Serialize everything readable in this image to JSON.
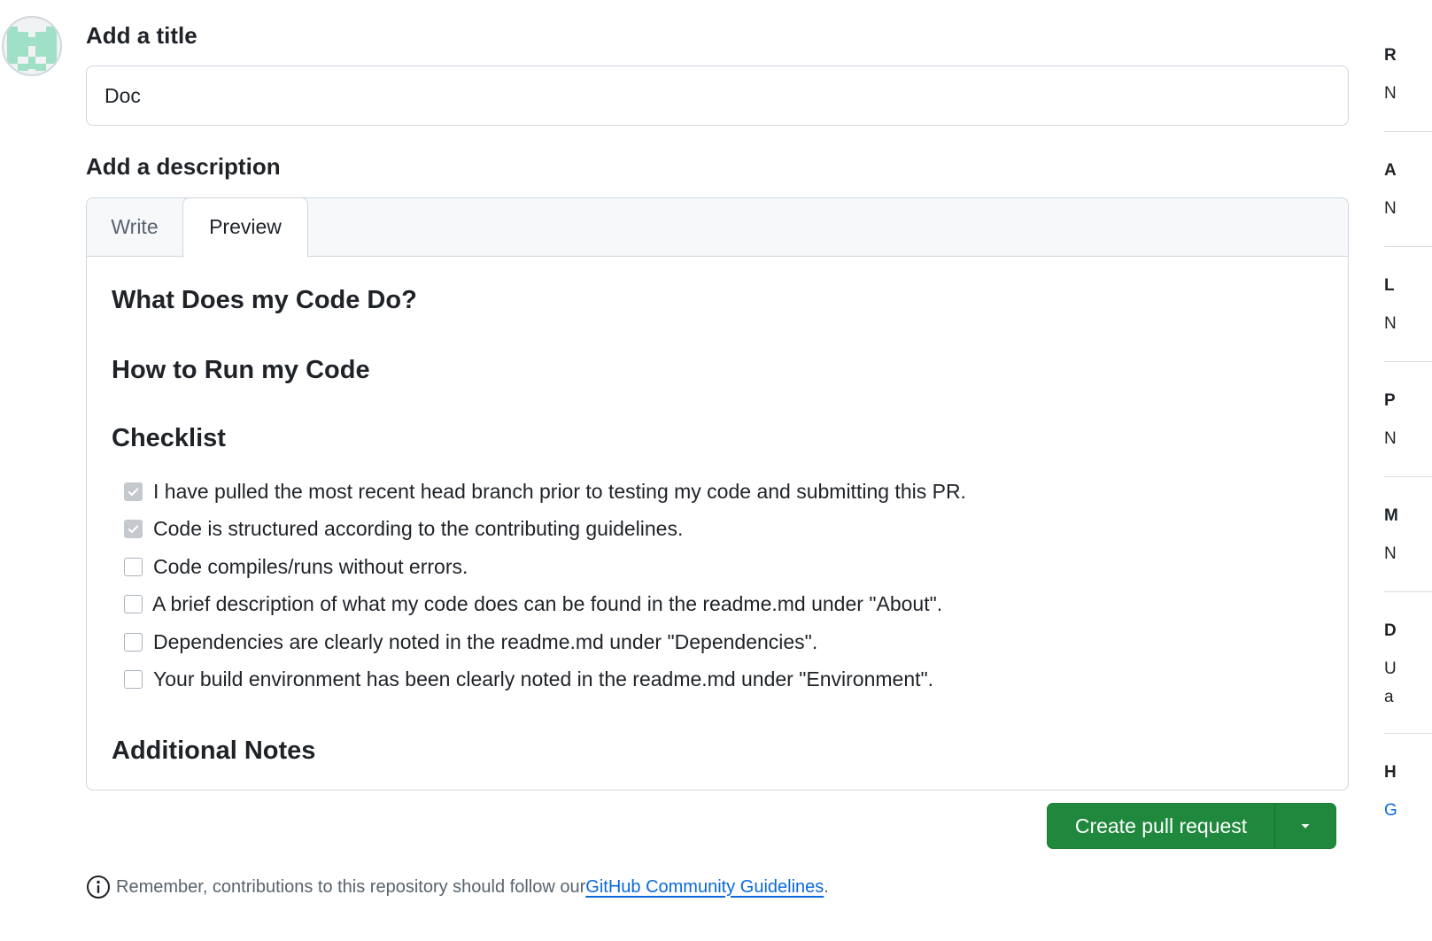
{
  "form": {
    "title_label": "Add a title",
    "title_value": "Doc",
    "description_label": "Add a description"
  },
  "editor": {
    "tabs": [
      {
        "label": "Write",
        "active": false
      },
      {
        "label": "Preview",
        "active": true
      }
    ],
    "preview": {
      "headings": [
        "What Does my Code Do?",
        "How to Run my Code",
        "Checklist",
        "Additional Notes"
      ],
      "checklist": [
        {
          "text": "I have pulled the most recent head branch prior to testing my code and submitting this PR.",
          "checked": true
        },
        {
          "text": "Code is structured according to the contributing guidelines.",
          "checked": true
        },
        {
          "text": "Code compiles/runs without errors.",
          "checked": false
        },
        {
          "text": "A brief description of what my code does can be found in the readme.md under \"About\".",
          "checked": false
        },
        {
          "text": "Dependencies are clearly noted in the readme.md under \"Dependencies\".",
          "checked": false
        },
        {
          "text": "Your build environment has been clearly noted in the readme.md under \"Environment\".",
          "checked": false
        }
      ]
    }
  },
  "actions": {
    "create_pr_label": "Create pull request",
    "dropdown_icon": "triangle-down-icon"
  },
  "footer": {
    "note_prefix": "Remember, contributions to this repository should follow our ",
    "link_text": "GitHub Community Guidelines",
    "note_suffix": ".",
    "icon": "info-icon"
  },
  "sidebar": {
    "visible_letters": [
      "R",
      "N",
      "A",
      "N",
      "L",
      "N",
      "P",
      "N",
      "M",
      "N",
      "D",
      "U",
      "a",
      "H",
      "G"
    ]
  },
  "colors": {
    "primary_button": "#1f883d",
    "link": "#0969da",
    "border": "#d0d7de",
    "header_bg": "#f6f8fa",
    "avatar_accent": "#9fe0c6"
  }
}
